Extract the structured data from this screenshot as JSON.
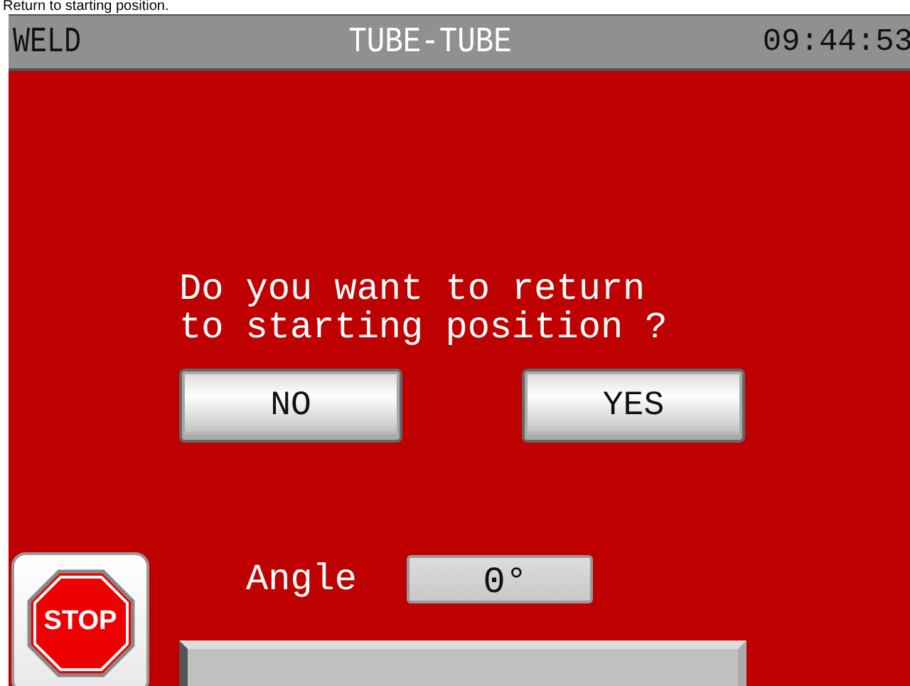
{
  "caption": "Return to starting position.",
  "title_bar": {
    "mode": "WELD",
    "title": "TUBE-TUBE",
    "time": "09:44:53"
  },
  "dialog": {
    "question_lines": [
      "Do you want to return",
      "to starting position ?"
    ],
    "buttons": [
      {
        "label": "NO"
      },
      {
        "label": "YES"
      }
    ]
  },
  "stop_button": {
    "label": "STOP"
  },
  "angle": {
    "label": "Angle",
    "value": "0°"
  },
  "progress": {
    "level": 0
  }
}
